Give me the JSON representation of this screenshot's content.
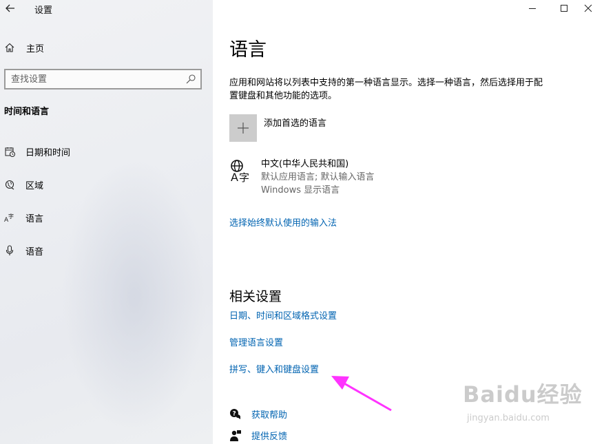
{
  "window": {
    "app_title": "设置",
    "controls": [
      "minimize",
      "maximize",
      "close"
    ]
  },
  "sidebar": {
    "home_label": "主页",
    "search_placeholder": "查找设置",
    "section_title": "时间和语言",
    "items": [
      {
        "label": "日期和时间",
        "icon": "calendar-clock-icon"
      },
      {
        "label": "区域",
        "icon": "globe-region-icon"
      },
      {
        "label": "语言",
        "icon": "language-icon"
      },
      {
        "label": "语音",
        "icon": "microphone-icon"
      }
    ]
  },
  "main": {
    "title": "语言",
    "description": "应用和网站将以列表中支持的第一种语言显示。选择一种语言，然后选择用于配置键盘和其他功能的选项。",
    "add_language_label": "添加首选的语言",
    "language": {
      "name": "中文(中华人民共和国)",
      "sub1": "默认应用语言; 默认输入语言",
      "sub2": "Windows 显示语言"
    },
    "input_method_link": "选择始终默认使用的输入法",
    "related": {
      "title": "相关设置",
      "links": [
        "日期、时间和区域格式设置",
        "管理语言设置",
        "拼写、键入和键盘设置"
      ]
    },
    "help": {
      "get_help": "获取帮助",
      "feedback": "提供反馈"
    }
  },
  "colors": {
    "link": "#0063b1",
    "annotation_arrow": "#ff33ff"
  },
  "watermark": {
    "main": "Baidu经验",
    "sub": "jingyan.baidu.com"
  }
}
